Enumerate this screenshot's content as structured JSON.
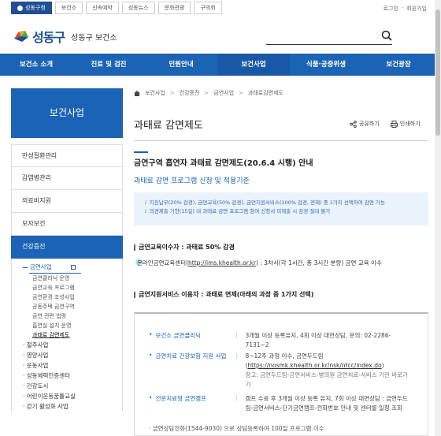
{
  "topbar": {
    "site_tabs": [
      "성동구청",
      "보건소",
      "신속예약",
      "성동뉴스",
      "문화관광",
      "구의회"
    ],
    "util_links": [
      "로그인",
      "·",
      "회원가입"
    ]
  },
  "header": {
    "logo_text": "성동구",
    "logo_sub": "성동구 보건소"
  },
  "nav": {
    "items": [
      "보건소 소개",
      "진료 및 검진",
      "민원안내",
      "보건사업",
      "식품·공중위생",
      "보건광장"
    ]
  },
  "sidebar": {
    "title": "보건사업",
    "items": [
      "만성질환관리",
      "감염병관리",
      "의료비지원",
      "모자보건",
      "건강증진"
    ],
    "sub_head": "금연사업",
    "sub_leaves": [
      "금연클리닉 운영",
      "금연교육 프로그램",
      "금연환경 조성사업",
      "공동주택 금연구역",
      "금연 관련 법령",
      "흡연실 설치 운영",
      "과태료 감면제도"
    ],
    "sub_cats": [
      "· 절주사업",
      "· 영양사업",
      "· 운동사업",
      "· 성동체력인증센터",
      "· 건강도시",
      "· 어린이운동꿈틀교실",
      "· 걷기 활성화 사업"
    ]
  },
  "content": {
    "breadcrumb": [
      "보건사업",
      "건강증진",
      "금연사업",
      "과태료감면제도"
    ],
    "page_title": "과태료 감면제도",
    "share_label": "공유하기",
    "print_label": "인쇄하기",
    "section_title": "금연구역 흡연자 과태료 감면제도(20.6.4 시행) 안내",
    "sub_title": "과태료 감면 프로그램 신청 및 적용기준",
    "notice": [
      "지진납부(20% 감경), 금연교육(50% 감경), 금연지원서비스(100% 감경, 면제) 중 1가지 선택하여 감면 가능",
      "의견제출 기한(15일) 내 과태료 감면 프로그램 참여 신청서 미제출 시 감경 절대 불가"
    ],
    "edu_head": "금연교육이수자 : 과태료 50% 감경",
    "edu_line_pre": "온라인금연교육센터(",
    "edu_link": "http://ims.khealth.or.kr",
    "edu_line_post": ") : 3차시(각 1시간, 총 3시간 분량) 금연 교육 이수",
    "support_head": "금연지원서비스 이용자 : 과태료 면제(아래의 과정 중 1가지 선택)",
    "support_rows": [
      {
        "label": "보건소 금연클리닉",
        "value": "3개월 이상 등록유지, 4회 이상 대면상담, 문의: 02-2286-7131~2"
      },
      {
        "label": "금연치료 건강보험 지원 사업",
        "value_a": "8~12주 과정 이수, 금연두드림",
        "value_link": "https://nosmk.khealth.or.kr/nsk/ntcc/index.do",
        "value_b": "참고: 금연두드림-금연서비스-병의원 금연치료-서비스 기관 바로가기"
      },
      {
        "label": "전문치료형 금연캠프",
        "value": "캠프 수료 후 3개월 이상 등록 유지, 7회 이상 대면상담 : 금연두드림-금연서비스-단기금연캠프-전화번호 안내 및 센터별 일정 조회"
      }
    ],
    "extra_row": "· 금연상담전화(1544-9030) 으로 상담등록하여 100일 프로그램 이수"
  },
  "colors": {
    "primary": "#1a63b5",
    "accent": "#1f4e96",
    "notice_bg": "#eaf2fa"
  }
}
